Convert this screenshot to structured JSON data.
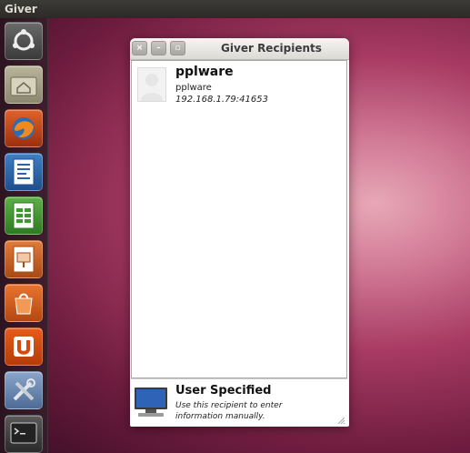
{
  "topbar": {
    "app_name": "Giver"
  },
  "launcher": {
    "items": [
      {
        "name": "ubuntu-dash-icon"
      },
      {
        "name": "home-folder-icon"
      },
      {
        "name": "firefox-icon"
      },
      {
        "name": "libreoffice-writer-icon"
      },
      {
        "name": "libreoffice-calc-icon"
      },
      {
        "name": "libreoffice-impress-icon"
      },
      {
        "name": "software-center-icon"
      },
      {
        "name": "ubuntu-one-icon"
      },
      {
        "name": "system-settings-icon"
      },
      {
        "name": "terminal-icon"
      }
    ]
  },
  "window": {
    "title": "Giver Recipients",
    "buttons": {
      "close": "×",
      "minimize": "–",
      "maximize": "▫"
    },
    "recipients": [
      {
        "name": "pplware",
        "user": "pplware",
        "address": "192.168.1.79:41653"
      }
    ],
    "user_specified": {
      "title": "User Specified",
      "line1": "Use this recipient to enter",
      "line2": "information manually."
    }
  },
  "colors": {
    "topbar": "#2b2a27",
    "desktop_accent": "#a73a62",
    "window_bg": "#ffffff"
  }
}
